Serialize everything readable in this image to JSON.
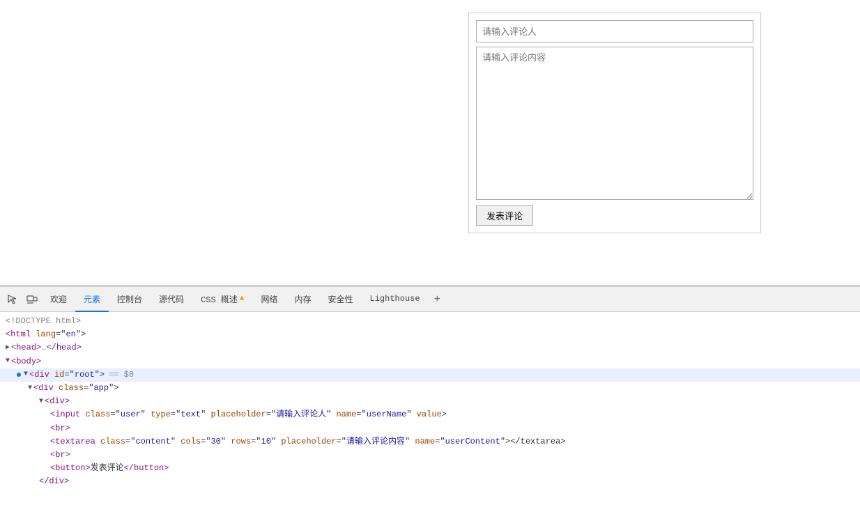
{
  "page": {
    "background": "#ffffff"
  },
  "comment_form": {
    "author_placeholder": "请输入评论人",
    "content_placeholder": "请输入评论内容",
    "submit_label": "发表评论"
  },
  "devtools": {
    "tabs": [
      {
        "id": "welcome",
        "label": "欢迎",
        "active": false
      },
      {
        "id": "elements",
        "label": "元素",
        "active": true
      },
      {
        "id": "console",
        "label": "控制台",
        "active": false
      },
      {
        "id": "sources",
        "label": "源代码",
        "active": false
      },
      {
        "id": "css",
        "label": "CSS 概述",
        "active": false,
        "warning": true
      },
      {
        "id": "network",
        "label": "网络",
        "active": false
      },
      {
        "id": "memory",
        "label": "内存",
        "active": false
      },
      {
        "id": "security",
        "label": "安全性",
        "active": false
      },
      {
        "id": "lighthouse",
        "label": "Lighthouse",
        "active": false
      }
    ],
    "code_lines": [
      {
        "indent": 0,
        "text": "<!DOCTYPE html>",
        "type": "doctype"
      },
      {
        "indent": 0,
        "text": "<html lang=\"en\">",
        "type": "tag-open"
      },
      {
        "indent": 0,
        "text": "▶ <head>…</head>",
        "type": "collapsed"
      },
      {
        "indent": 0,
        "text": "▼ <body>",
        "type": "tag-open-expand"
      },
      {
        "indent": 1,
        "text": "▼ <div id=\"root\"> == $0",
        "type": "tag-highlighted",
        "selected": true
      },
      {
        "indent": 2,
        "text": "▼ <div class=\"app\">",
        "type": "tag"
      },
      {
        "indent": 3,
        "text": "▼ <div>",
        "type": "tag"
      },
      {
        "indent": 4,
        "text": "<input class=\"user\" type=\"text\" placeholder=\"请输入评论人\" name=\"userName\" value>",
        "type": "self-closing"
      },
      {
        "indent": 4,
        "text": "<br>",
        "type": "self-closing"
      },
      {
        "indent": 4,
        "text": "<textarea class=\"content\" cols=\"30\" rows=\"10\" placeholder=\"请输入评论内容\" name=\"userContent\"></textarea>",
        "type": "tag"
      },
      {
        "indent": 4,
        "text": "<br>",
        "type": "self-closing"
      },
      {
        "indent": 4,
        "text": "<button>发表评论</button>",
        "type": "tag"
      }
    ]
  }
}
